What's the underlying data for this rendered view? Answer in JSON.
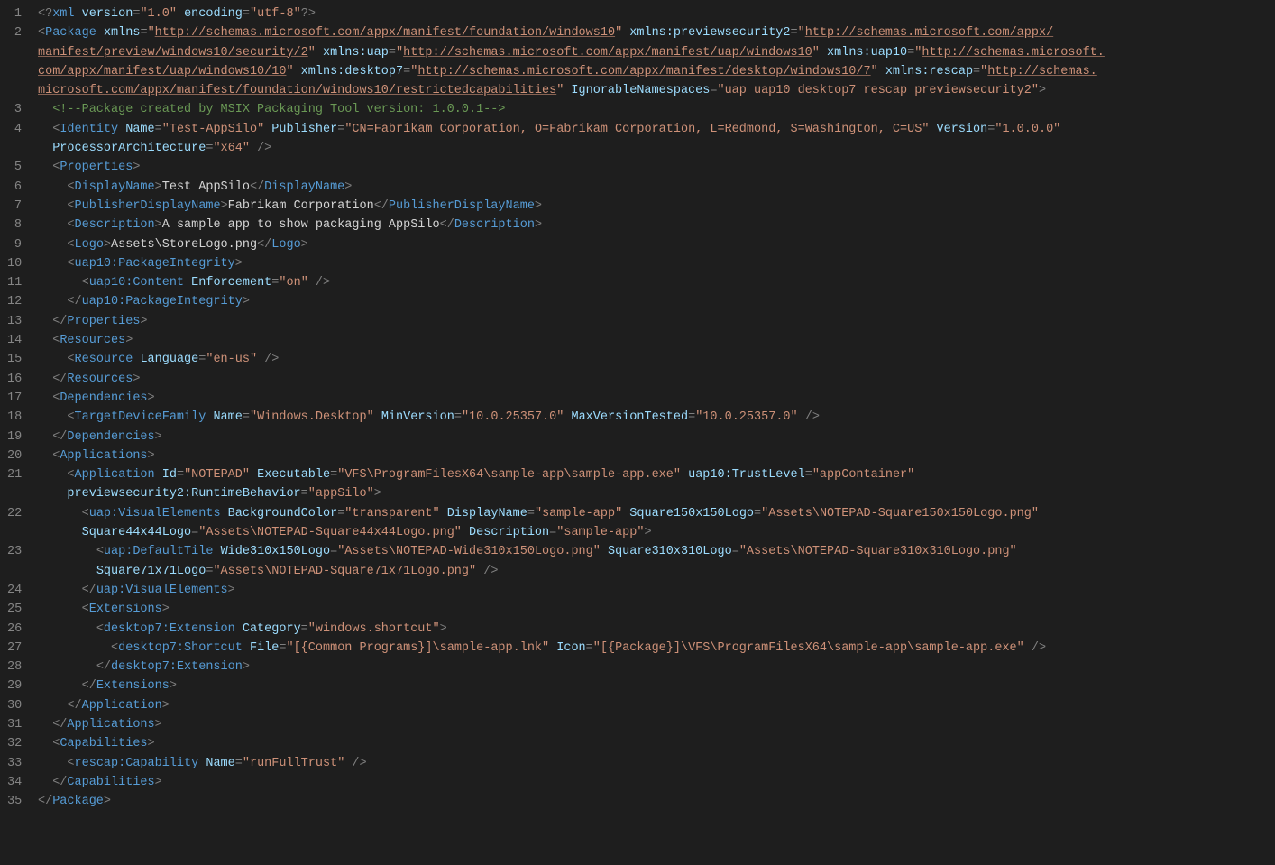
{
  "lineNumbers": [
    "1",
    "2",
    "",
    "",
    "3",
    "4",
    "",
    "5",
    "6",
    "7",
    "8",
    "9",
    "10",
    "11",
    "12",
    "13",
    "14",
    "15",
    "16",
    "17",
    "18",
    "19",
    "20",
    "21",
    "",
    "22",
    "",
    "23",
    "",
    "24",
    "25",
    "26",
    "27",
    "28",
    "29",
    "30",
    "31",
    "32",
    "33",
    "34",
    "35"
  ],
  "xml": {
    "declaration": {
      "version": "1.0",
      "encoding": "utf-8"
    },
    "root": {
      "tag": "Package",
      "attrs": {
        "xmlns": "http://schemas.microsoft.com/appx/manifest/foundation/windows10",
        "xmlns:previewsecurity2": "http://schemas.microsoft.com/appx/manifest/preview/windows10/security/2",
        "xmlns:uap": "http://schemas.microsoft.com/appx/manifest/uap/windows10",
        "xmlns:uap10": "http://schemas.microsoft.com/appx/manifest/uap/windows10/10",
        "xmlns:desktop7": "http://schemas.microsoft.com/appx/manifest/desktop/windows10/7",
        "xmlns:rescap": "http://schemas.microsoft.com/appx/manifest/foundation/windows10/restrictedcapabilities",
        "IgnorableNamespaces": "uap uap10 desktop7 rescap previewsecurity2"
      },
      "comment": "Package created by MSIX Packaging Tool version: 1.0.0.1",
      "Identity": {
        "Name": "Test-AppSilo",
        "Publisher": "CN=Fabrikam Corporation, O=Fabrikam Corporation, L=Redmond, S=Washington, C=US",
        "Version": "1.0.0.0",
        "ProcessorArchitecture": "x64"
      },
      "Properties": {
        "DisplayName": "Test AppSilo",
        "PublisherDisplayName": "Fabrikam Corporation",
        "Description": "A sample app to show packaging AppSilo",
        "Logo": "Assets\\StoreLogo.png",
        "uap10:PackageIntegrity": {
          "uap10:Content": {
            "Enforcement": "on"
          }
        }
      },
      "Resources": {
        "Resource": {
          "Language": "en-us"
        }
      },
      "Dependencies": {
        "TargetDeviceFamily": {
          "Name": "Windows.Desktop",
          "MinVersion": "10.0.25357.0",
          "MaxVersionTested": "10.0.25357.0"
        }
      },
      "Applications": {
        "Application": {
          "Id": "NOTEPAD",
          "Executable": "VFS\\ProgramFilesX64\\sample-app\\sample-app.exe",
          "uap10:TrustLevel": "appContainer",
          "previewsecurity2:RuntimeBehavior": "appSilo",
          "uap:VisualElements": {
            "BackgroundColor": "transparent",
            "DisplayName": "sample-app",
            "Square150x150Logo": "Assets\\NOTEPAD-Square150x150Logo.png",
            "Square44x44Logo": "Assets\\NOTEPAD-Square44x44Logo.png",
            "Description": "sample-app",
            "uap:DefaultTile": {
              "Wide310x150Logo": "Assets\\NOTEPAD-Wide310x150Logo.png",
              "Square310x310Logo": "Assets\\NOTEPAD-Square310x310Logo.png",
              "Square71x71Logo": "Assets\\NOTEPAD-Square71x71Logo.png"
            }
          },
          "Extensions": {
            "desktop7:Extension": {
              "Category": "windows.shortcut",
              "desktop7:Shortcut": {
                "File": "[{Common Programs}]\\sample-app.lnk",
                "Icon": "[{Package}]\\VFS\\ProgramFilesX64\\sample-app\\sample-app.exe"
              }
            }
          }
        }
      },
      "Capabilities": {
        "rescap:Capability": {
          "Name": "runFullTrust"
        }
      }
    }
  }
}
